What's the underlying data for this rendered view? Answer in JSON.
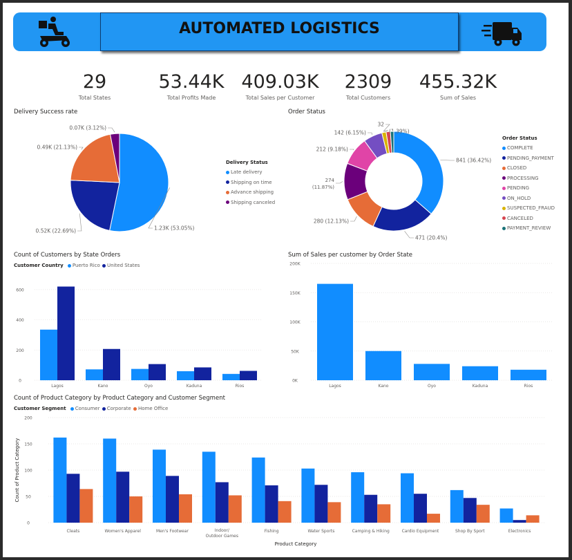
{
  "header": {
    "title": "AUTOMATED LOGISTICS",
    "left_icon": "delivery-scooter-icon",
    "right_icon": "delivery-truck-icon"
  },
  "kpis": [
    {
      "value": "29",
      "label": "Total States"
    },
    {
      "value": "53.44K",
      "label": "Total Profits Made"
    },
    {
      "value": "409.03K",
      "label": "Total Sales per Customer"
    },
    {
      "value": "2309",
      "label": "Total Customers"
    },
    {
      "value": "455.32K",
      "label": "Sum of Sales"
    }
  ],
  "colors": {
    "blue": "#118dff",
    "navy": "#12239e",
    "orange": "#e66c37",
    "purple": "#6b007b",
    "banner": "#2196f3"
  },
  "chart_data": [
    {
      "type": "pie",
      "title": "Delivery Success rate",
      "legend_title": "Delivery Status",
      "legend_position": "right",
      "slices": [
        {
          "name": "Late delivery",
          "value": 1230,
          "label": "1.23K (53.05%)",
          "color": "#118dff"
        },
        {
          "name": "Shipping on time",
          "value": 520,
          "label": "0.52K (22.69%)",
          "color": "#12239e"
        },
        {
          "name": "Advance shipping",
          "value": 490,
          "label": "0.49K (21.13%)",
          "color": "#e66c37"
        },
        {
          "name": "Shipping canceled",
          "value": 70,
          "label": "0.07K (3.12%)",
          "color": "#6b007b"
        }
      ]
    },
    {
      "type": "pie",
      "title": "Order Status",
      "legend_title": "Order Status",
      "legend_position": "right",
      "slices": [
        {
          "name": "COMPLETE",
          "value": 841,
          "label": "841 (36.42%)",
          "color": "#118dff"
        },
        {
          "name": "PENDING_PAYMENT",
          "value": 471,
          "label": "471 (20.4%)",
          "color": "#12239e"
        },
        {
          "name": "CLOSED",
          "value": 280,
          "label": "280 (12.13%)",
          "color": "#e66c37"
        },
        {
          "name": "PROCESSING",
          "value": 274,
          "label": "274 (11.87%)",
          "color": "#6b007b"
        },
        {
          "name": "PENDING",
          "value": 212,
          "label": "212 (9.18%)",
          "color": "#e044a7"
        },
        {
          "name": "ON_HOLD",
          "value": 142,
          "label": "142 (6.15%)",
          "color": "#744ec2"
        },
        {
          "name": "SUSPECTED_FRAUD",
          "value": 32,
          "label": "32",
          "color": "#d9b300"
        },
        {
          "name": "CANCELED",
          "value": 32,
          "label": "(1.39%)",
          "color": "#d64550"
        },
        {
          "name": "PAYMENT_REVIEW",
          "value": 25,
          "label": "",
          "color": "#197278"
        }
      ]
    },
    {
      "type": "bar",
      "title": "Count of Customers by State Orders",
      "legend_title": "Customer Country",
      "legend_position": "top-left",
      "categories": [
        "Lagos",
        "Kano",
        "Oyo",
        "Kaduna",
        "Rios"
      ],
      "series": [
        {
          "name": "Puerto Rico",
          "values": [
            335,
            72,
            75,
            60,
            42
          ],
          "color": "#118dff"
        },
        {
          "name": "United States",
          "values": [
            620,
            207,
            107,
            85,
            62
          ],
          "color": "#12239e"
        }
      ],
      "yticks": [
        "0",
        "200",
        "400",
        "600"
      ],
      "ylim": [
        0,
        700
      ],
      "grid": true
    },
    {
      "type": "bar",
      "title": "Sum of Sales per customer by Order State",
      "categories": [
        "Lagos",
        "Kano",
        "Oyo",
        "Kaduna",
        "Rios"
      ],
      "series": [
        {
          "values": [
            165000,
            50000,
            28000,
            24000,
            18000
          ],
          "color": "#118dff"
        }
      ],
      "yticks": [
        "0K",
        "50K",
        "100K",
        "150K",
        "200K"
      ],
      "ylim": [
        0,
        200000
      ],
      "grid": true
    },
    {
      "type": "bar",
      "title": "Count of Product Category by Product Category and Customer Segment",
      "legend_title": "Customer Segment",
      "legend_position": "top-left",
      "categories": [
        "Cleats",
        "Women's Apparel",
        "Men's Footwear",
        "Indoor/Outdoor Games",
        "Fishing",
        "Water Sports",
        "Camping & Hiking",
        "Cardio Equipment",
        "Shop By Sport",
        "Electronics"
      ],
      "series": [
        {
          "name": "Consumer",
          "values": [
            162,
            160,
            139,
            135,
            124,
            103,
            96,
            94,
            62,
            27
          ],
          "color": "#118dff"
        },
        {
          "name": "Corporate",
          "values": [
            93,
            97,
            89,
            77,
            71,
            72,
            53,
            55,
            47,
            5
          ],
          "color": "#12239e"
        },
        {
          "name": "Home Office",
          "values": [
            64,
            50,
            54,
            52,
            41,
            39,
            35,
            17,
            34,
            14
          ],
          "color": "#e66c37"
        }
      ],
      "xlabel": "Product Category",
      "ylabel": "Count of Product Category",
      "yticks": [
        "0",
        "50",
        "100",
        "150",
        "200"
      ],
      "ylim": [
        0,
        200
      ],
      "grid": true
    }
  ]
}
